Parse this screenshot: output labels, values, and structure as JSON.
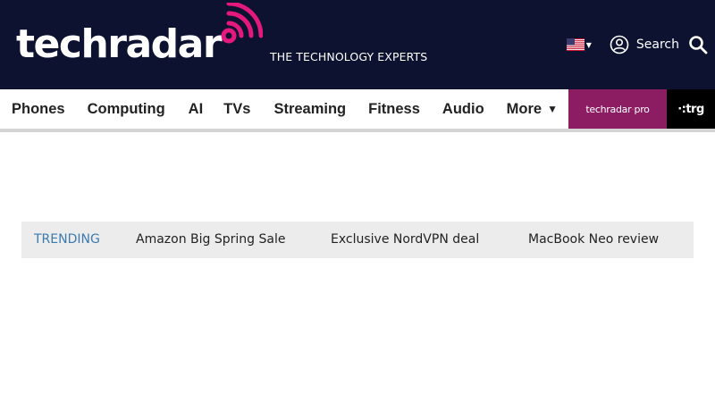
{
  "header": {
    "logo_text": "techradar",
    "tagline": "THE TECHNOLOGY EXPERTS",
    "search_label": "Search",
    "region": "United States"
  },
  "nav": {
    "items": [
      "Phones",
      "Computing",
      "AI",
      "TVs",
      "Streaming",
      "Fitness",
      "Audio"
    ],
    "more_label": "More",
    "pro_tile": {
      "text_main": "techradar",
      "text_suffix": "pro"
    },
    "trg_tile": {
      "text": "trg"
    }
  },
  "trending": {
    "label": "TRENDING",
    "links": [
      "Amazon Big Spring Sale",
      "Exclusive NordVPN deal",
      "MacBook Neo review"
    ]
  },
  "colors": {
    "header_bg": "#0d1230",
    "brand_pink": "#e4187d",
    "pro_tile_bg": "#8c1d63",
    "trending_label": "#3d7ab0",
    "trending_bg": "#ececec"
  },
  "icons": [
    "us-flag-icon",
    "account-icon",
    "search-icon",
    "chevron-down-icon",
    "signal-icon"
  ]
}
